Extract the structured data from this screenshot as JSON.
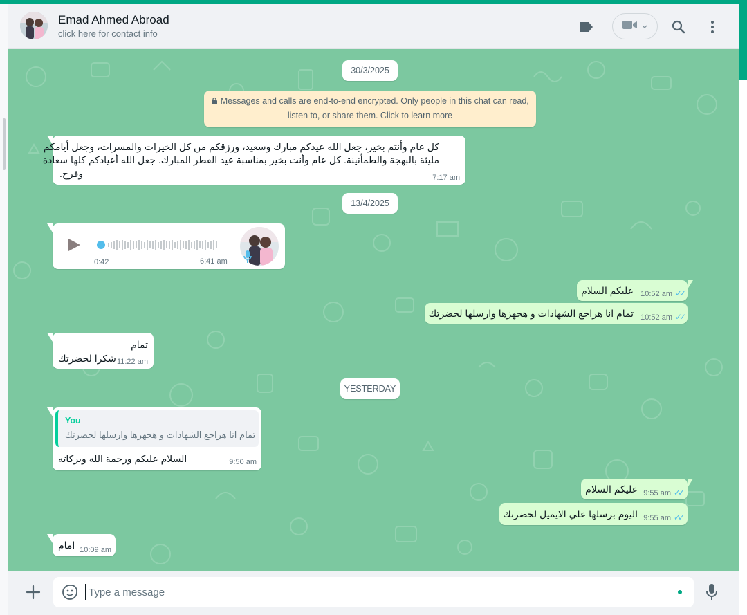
{
  "header": {
    "contact_name": "Emad Ahmed Abroad",
    "contact_sub": "click here for contact info",
    "icons": [
      "label-icon",
      "video-call-icon",
      "search-icon",
      "menu-icon"
    ]
  },
  "colors": {
    "accent": "#00a884",
    "chat_bg": "#7cc8a0",
    "incoming_bubble": "#ffffff",
    "outgoing_bubble": "#d9fdd3",
    "encryption_notice_bg": "#ffeecd",
    "read_ticks": "#53bdeb"
  },
  "dates": {
    "d1": "30/3/2025",
    "d2": "13/4/2025",
    "d3": "YESTERDAY"
  },
  "encryption_notice": {
    "line1": "Messages and calls are end-to-end encrypted. Only people in this chat can read,",
    "line2": "listen to, or share them. Click to learn more"
  },
  "messages": {
    "m1": {
      "direction": "incoming",
      "line1": "كل عام وأنتم بخير، جعل الله عيدكم مبارك وسعيد، ورزقكم من كل الخيرات والمسرات، وجعل أيامكم",
      "line2": "مليئة بالبهجة والطمأنينة. كل عام وأنت بخير بمناسبة عيد الفطر المبارك. جعل الله أعيادكم كلها سعادة",
      "line3": "وفرح.",
      "time": "7:17 am"
    },
    "voice": {
      "direction": "incoming",
      "duration": "0:42",
      "time": "6:41 am"
    },
    "m2": {
      "direction": "outgoing",
      "text": "عليكم السلام",
      "time": "10:52 am"
    },
    "m3": {
      "direction": "outgoing",
      "text": "تمام انا هراجع الشهادات و هجهزها وارسلها لحضرتك",
      "time": "10:52 am"
    },
    "m4": {
      "direction": "incoming",
      "line1": "تمام",
      "line2": "شكرا لحضرتك",
      "time": "11:22 am"
    },
    "m5": {
      "direction": "incoming",
      "quote_author": "You",
      "quote_text": "تمام انا هراجع الشهادات و هجهزها وارسلها لحضرتك",
      "text": "السلام عليكم ورحمة الله وبركاته",
      "time": "9:50 am"
    },
    "m6": {
      "direction": "outgoing",
      "text": "عليكم السلام",
      "time": "9:55 am"
    },
    "m7": {
      "direction": "outgoing",
      "text": "اليوم برسلها علي الايميل لحضرتك",
      "time": "9:55 am"
    },
    "m8": {
      "direction": "incoming",
      "text": "امام",
      "time": "10:09 am"
    }
  },
  "composer": {
    "placeholder": "Type a message"
  }
}
